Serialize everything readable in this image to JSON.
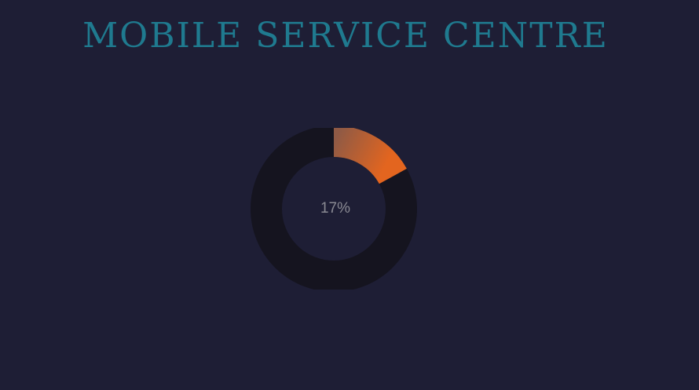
{
  "header": {
    "title": "MOBILE SERVICE CENTRE"
  },
  "progress": {
    "value": 0.17,
    "label": "17%"
  },
  "colors": {
    "background": "#1e1e35",
    "title": "#1f7a8f",
    "track": "#15141f",
    "arc_start": "#8f5a45",
    "arc_end": "#e3651f",
    "label": "#8a8a93"
  }
}
